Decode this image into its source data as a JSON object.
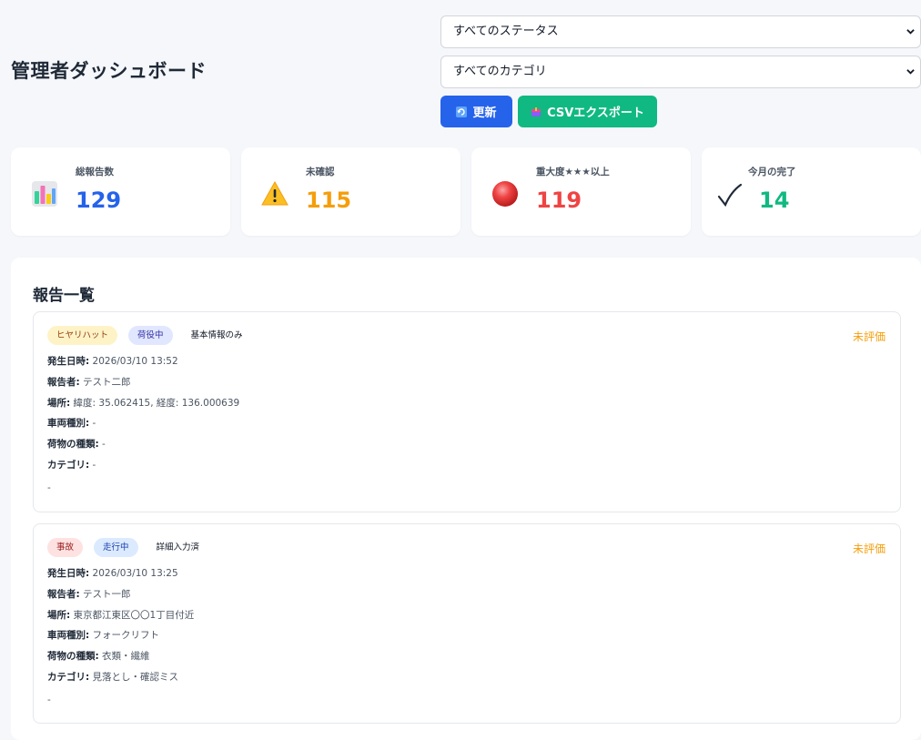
{
  "header": {
    "title": "管理者ダッシュボード",
    "status_filter": "すべてのステータス",
    "category_filter": "すべてのカテゴリ",
    "refresh_label": "更新",
    "export_label": "CSVエクスポート"
  },
  "stats": [
    {
      "label": "総報告数",
      "value": "129",
      "color": "#2563eb",
      "icon": "bar-chart-icon"
    },
    {
      "label": "未確認",
      "value": "115",
      "color": "#f59e0b",
      "icon": "warning-icon"
    },
    {
      "label": "重大度★★★以上",
      "value": "119",
      "color": "#ef4444",
      "icon": "red-circle-icon"
    },
    {
      "label": "今月の完了",
      "value": "14",
      "color": "#10b981",
      "icon": "checkmark-icon"
    }
  ],
  "list": {
    "title": "報告一覧",
    "reports": [
      {
        "type_tag": "ヒヤリハット",
        "status_tag": "荷役中",
        "detail_tag": "基本情報のみ",
        "evaluation": "未評価",
        "fields": [
          {
            "label": "発生日時:",
            "value": "2026/03/10 13:52"
          },
          {
            "label": "報告者:",
            "value": "テスト二郎"
          },
          {
            "label": "場所:",
            "value": "緯度: 35.062415, 経度: 136.000639"
          },
          {
            "label": "車両種別:",
            "value": "-"
          },
          {
            "label": "荷物の種類:",
            "value": "-"
          },
          {
            "label": "カテゴリ:",
            "value": "-"
          }
        ],
        "description": "-"
      },
      {
        "type_tag": "事故",
        "status_tag": "走行中",
        "detail_tag": "詳細入力済",
        "evaluation": "未評価",
        "fields": [
          {
            "label": "発生日時:",
            "value": "2026/03/10 13:25"
          },
          {
            "label": "報告者:",
            "value": "テスト一郎"
          },
          {
            "label": "場所:",
            "value": "東京都江東区〇〇1丁目付近"
          },
          {
            "label": "車両種別:",
            "value": "フォークリフト"
          },
          {
            "label": "荷物の種類:",
            "value": "衣類・繊維"
          },
          {
            "label": "カテゴリ:",
            "value": "見落とし・確認ミス"
          }
        ],
        "description": "-"
      }
    ]
  }
}
